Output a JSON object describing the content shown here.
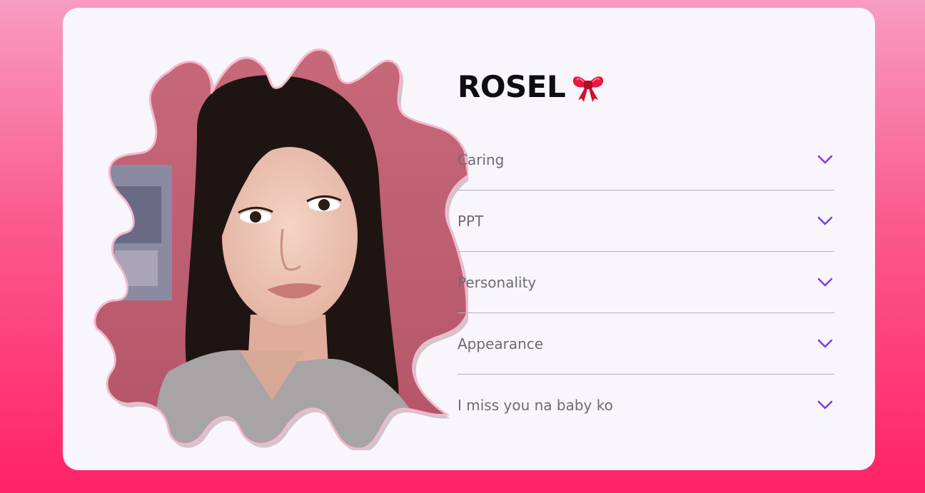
{
  "profile": {
    "name": "ROSEL",
    "name_emoji_icon": "ribbon-bow-icon"
  },
  "accordion": {
    "items": [
      {
        "label": "Caring",
        "icon": "chevron-down-icon",
        "expanded": false
      },
      {
        "label": "PPT",
        "icon": "chevron-down-icon",
        "expanded": false
      },
      {
        "label": "Personality",
        "icon": "chevron-down-icon",
        "expanded": false
      },
      {
        "label": "Appearance",
        "icon": "chevron-down-icon",
        "expanded": false
      },
      {
        "label": "I miss you na baby ko",
        "icon": "chevron-down-icon",
        "expanded": false
      }
    ]
  },
  "colors": {
    "background_top": "#f79dbf",
    "background_bottom": "#ff2266",
    "card": "#f8f5fb",
    "chevron": "#7b3fe4",
    "label_text": "#6d6a78",
    "divider": "#b5b1bd",
    "title_text": "#0d0d14"
  }
}
